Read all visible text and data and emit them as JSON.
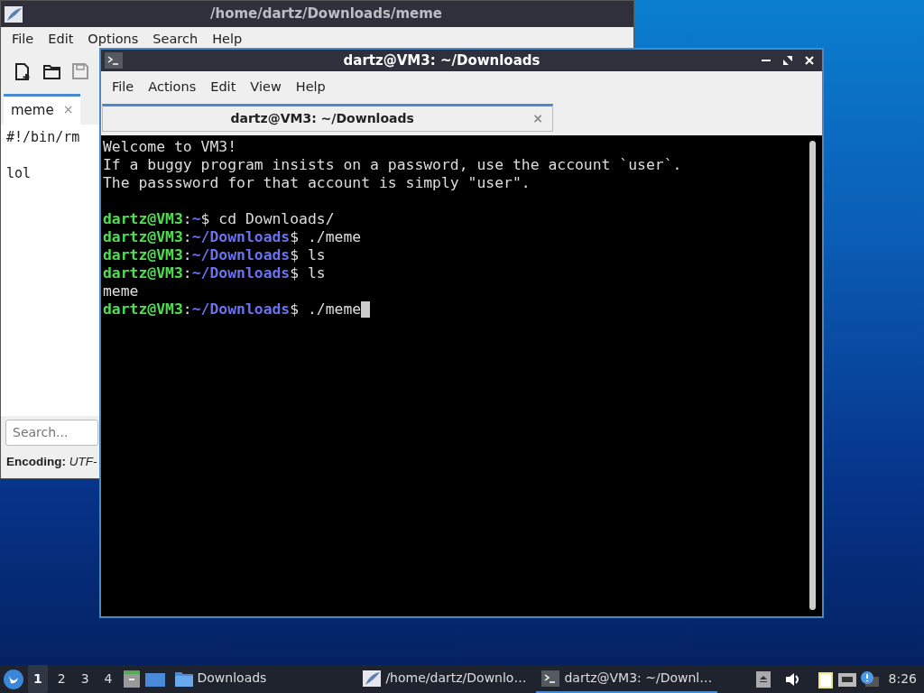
{
  "editor": {
    "title": "/home/dartz/Downloads/meme",
    "menu": [
      "File",
      "Edit",
      "Options",
      "Search",
      "Help"
    ],
    "toolbar": [
      {
        "kind": "new",
        "disabled": false
      },
      {
        "kind": "open",
        "disabled": false
      },
      {
        "kind": "save",
        "disabled": true
      }
    ],
    "tabs": [
      {
        "label": "meme",
        "close": "×",
        "selected": true
      }
    ],
    "lines": [
      {
        "kind": "text",
        "text": "#!/bin/rm"
      },
      {
        "kind": "blank"
      },
      {
        "kind": "text",
        "text": "lol"
      }
    ],
    "search": {
      "placeholder": "Search..."
    },
    "status": {
      "label": "Encoding:",
      "value": "UTF-"
    }
  },
  "terminal": {
    "title": "dartz@VM3: ~/Downloads",
    "menu": [
      "File",
      "Actions",
      "Edit",
      "View",
      "Help"
    ],
    "tabs": [
      {
        "label": "dartz@VM3: ~/Downloads",
        "close": "×",
        "selected": true
      }
    ],
    "lines": [
      {
        "kind": "text",
        "text": "Welcome to VM3!"
      },
      {
        "kind": "text",
        "text": "If a buggy program insists on a password, use the account `user`."
      },
      {
        "kind": "text",
        "text": "The passsword for that account is simply \"user\"."
      },
      {
        "kind": "blank"
      },
      {
        "kind": "prompt",
        "user": "dartz@VM3",
        "sep": ":",
        "path": "~",
        "command": "$ cd Downloads/"
      },
      {
        "kind": "prompt",
        "user": "dartz@VM3",
        "sep": ":",
        "path": "~/Downloads",
        "command": "$ ./meme"
      },
      {
        "kind": "prompt",
        "user": "dartz@VM3",
        "sep": ":",
        "path": "~/Downloads",
        "command": "$ ls"
      },
      {
        "kind": "prompt",
        "user": "dartz@VM3",
        "sep": ":",
        "path": "~/Downloads",
        "command": "$ ls"
      },
      {
        "kind": "text",
        "text": "meme"
      },
      {
        "kind": "prompt",
        "user": "dartz@VM3",
        "sep": ":",
        "path": "~/Downloads",
        "command": "$ ./meme",
        "cursor": true
      }
    ]
  },
  "taskbar": {
    "workspaces": [
      {
        "label": "1",
        "selected": true
      },
      {
        "label": "2",
        "selected": false
      },
      {
        "label": "3",
        "selected": false
      },
      {
        "label": "4",
        "selected": false
      }
    ],
    "tasks": [
      {
        "kind": "folder",
        "label": "Downloads",
        "selected": false
      },
      {
        "kind": "editor",
        "label": "/home/dartz/Downlo…",
        "selected": false
      },
      {
        "kind": "terminal",
        "label": "dartz@VM3: ~/Downl…",
        "selected": true
      }
    ],
    "clock": "8:26"
  }
}
